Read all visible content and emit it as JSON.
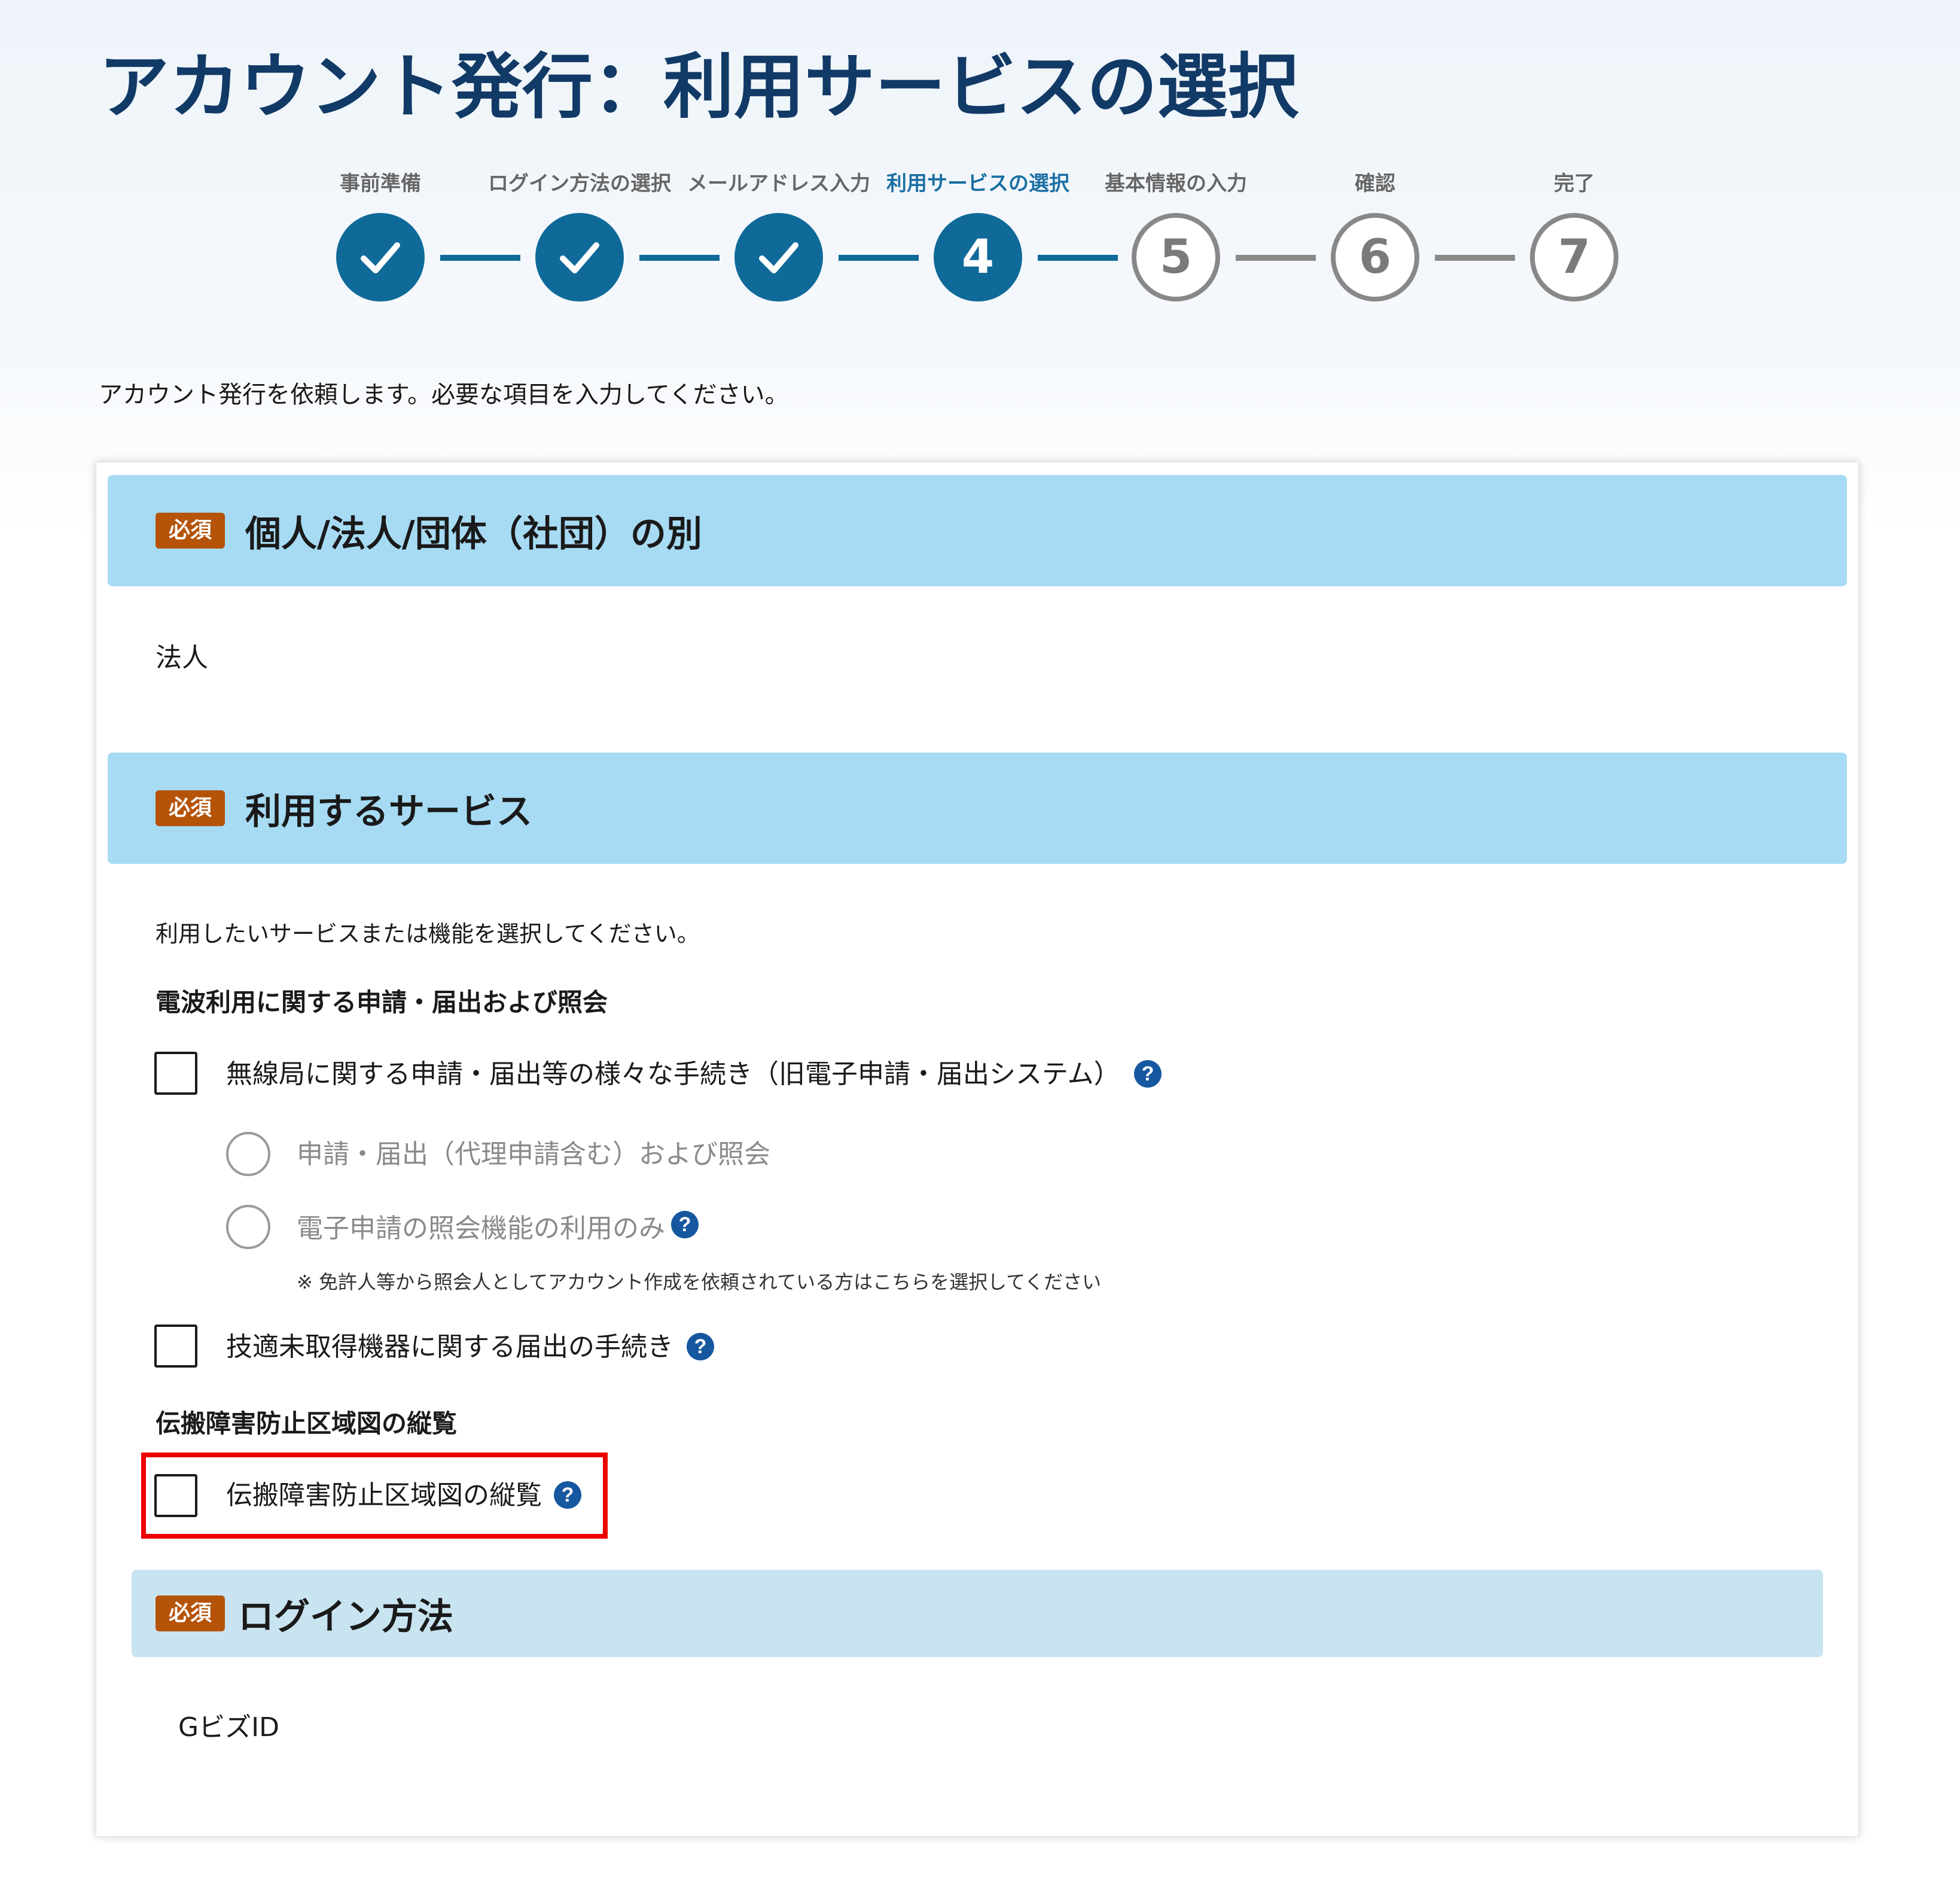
{
  "page": {
    "title": "アカウント発行：利用サービスの選択",
    "intro": "アカウント発行を依頼します。必要な項目を入力してください。"
  },
  "stepper": {
    "steps": [
      {
        "label": "事前準備",
        "state": "done",
        "number": "1"
      },
      {
        "label": "ログイン方法の選択",
        "state": "done",
        "number": "2"
      },
      {
        "label": "メールアドレス入力",
        "state": "done",
        "number": "3"
      },
      {
        "label": "利用サービスの選択",
        "state": "current",
        "number": "4"
      },
      {
        "label": "基本情報の入力",
        "state": "todo",
        "number": "5"
      },
      {
        "label": "確認",
        "state": "todo",
        "number": "6"
      },
      {
        "label": "完了",
        "state": "todo",
        "number": "7"
      }
    ]
  },
  "required_label": "必須",
  "sections": {
    "entity": {
      "title": "個人/法人/団体（社団）の別",
      "value": "法人"
    },
    "services": {
      "title": "利用するサービス",
      "description": "利用したいサービスまたは機能を選択してください。",
      "group1": {
        "title": "電波利用に関する申請・届出および照会",
        "option_main": "無線局に関する申請・届出等の様々な手続き（旧電子申請・届出システム）",
        "radio1": "申請・届出（代理申請含む）および照会",
        "radio2": "電子申請の照会機能の利用のみ",
        "note": "※ 免許人等から照会人としてアカウント作成を依頼されている方はこちらを選択してください",
        "option2": "技適未取得機器に関する届出の手続き"
      },
      "group2": {
        "title": "伝搬障害防止区域図の縦覧",
        "option": "伝搬障害防止区域図の縦覧"
      }
    },
    "login": {
      "title": "ログイン方法",
      "value": "GビズID"
    }
  },
  "help_glyph": "?",
  "colors": {
    "title": "#113a66",
    "step_active": "#0f6a99",
    "step_inactive": "#888888",
    "section_header": "#a7dbf4",
    "section_header_alt": "#c9e4f1",
    "badge": "#b55308",
    "help_icon": "#1658a0",
    "highlight": "#ee0000"
  },
  "icons": {
    "done_step": "check-icon",
    "help": "question-circle-icon"
  }
}
